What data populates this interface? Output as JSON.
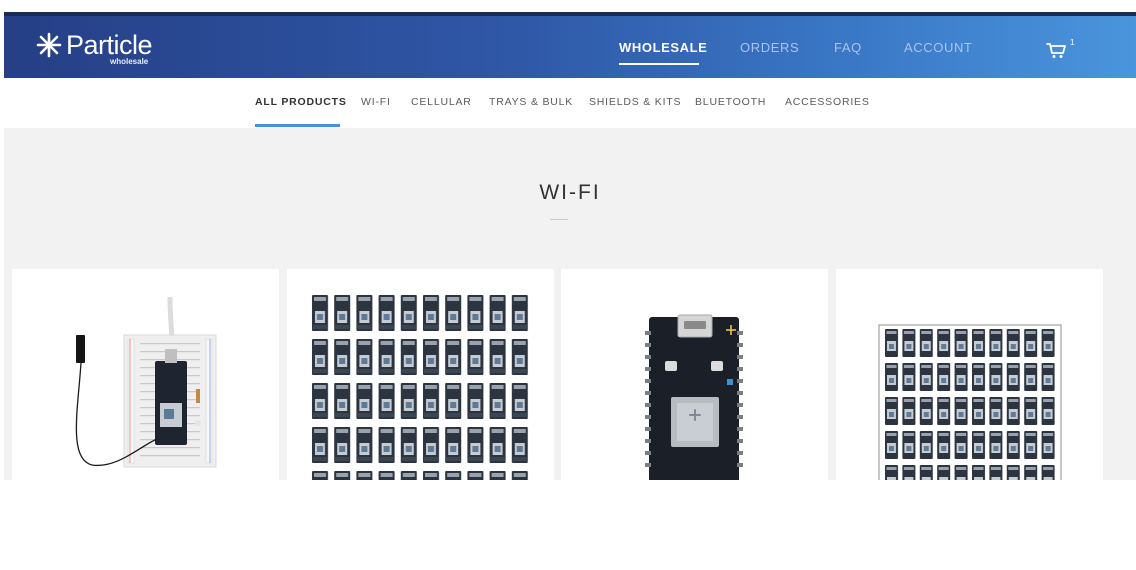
{
  "header": {
    "logo_text": "Particle",
    "logo_sub": "wholesale",
    "nav": [
      {
        "label": "WHOLESALE",
        "active": true
      },
      {
        "label": "ORDERS",
        "active": false
      },
      {
        "label": "FAQ",
        "active": false
      },
      {
        "label": "ACCOUNT",
        "active": false
      }
    ],
    "cart_count": "1"
  },
  "subnav": {
    "items": [
      {
        "label": "ALL PRODUCTS",
        "active": true
      },
      {
        "label": "WI-FI",
        "active": false
      },
      {
        "label": "CELLULAR",
        "active": false
      },
      {
        "label": "TRAYS & BULK",
        "active": false
      },
      {
        "label": "SHIELDS & KITS",
        "active": false
      },
      {
        "label": "BLUETOOTH",
        "active": false
      },
      {
        "label": "ACCESSORIES",
        "active": false
      }
    ]
  },
  "section": {
    "title": "WI-FI"
  },
  "products": [
    {
      "image": "photon-kit-on-breadboard-with-antenna"
    },
    {
      "image": "photon-tray-bulk-grid"
    },
    {
      "image": "photon-board-closeup"
    },
    {
      "image": "photon-tray-bulk-grid-bordered"
    }
  ],
  "colors": {
    "header_start": "#263f86",
    "header_end": "#4a95dc",
    "accent_underline": "#4a90d9",
    "content_bg": "#f2f2f2"
  }
}
